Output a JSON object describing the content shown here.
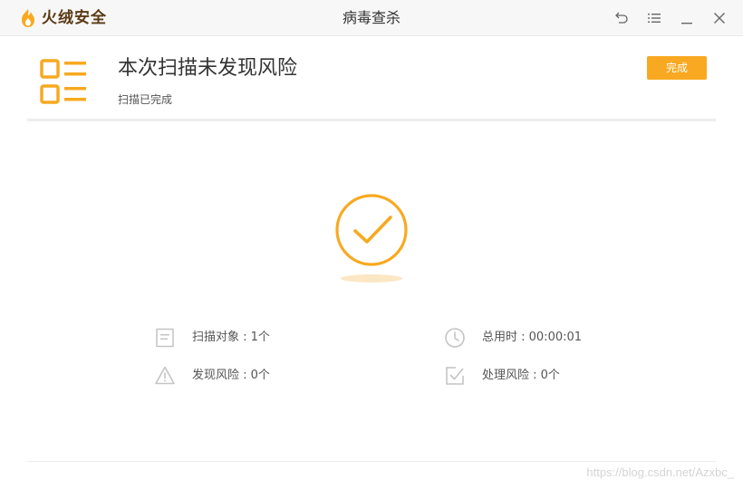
{
  "app": {
    "brand_name": "火绒安全",
    "window_title": "病毒查杀"
  },
  "window_controls": [
    "back-icon",
    "menu-icon",
    "minimize-icon",
    "close-icon"
  ],
  "result": {
    "headline": "本次扫描未发现风险",
    "subtitle": "扫描已完成",
    "done_label": "完成",
    "status": "success"
  },
  "stats": [
    {
      "icon": "document-icon",
      "text": "扫描对象 : 1个"
    },
    {
      "icon": "clock-icon",
      "text": "总用时 : 00:00:01"
    },
    {
      "icon": "warning-icon",
      "text": "发现风险 : 0个"
    },
    {
      "icon": "checkbox-icon",
      "text": "处理风险 : 0个"
    }
  ],
  "watermark": "https://blog.csdn.net/Azxbc_",
  "colors": {
    "accent": "#f8a921",
    "brand_text": "#5a3a14",
    "icon_gray": "#c4c4c4",
    "titlebar_bg": "#f7f7f7"
  }
}
